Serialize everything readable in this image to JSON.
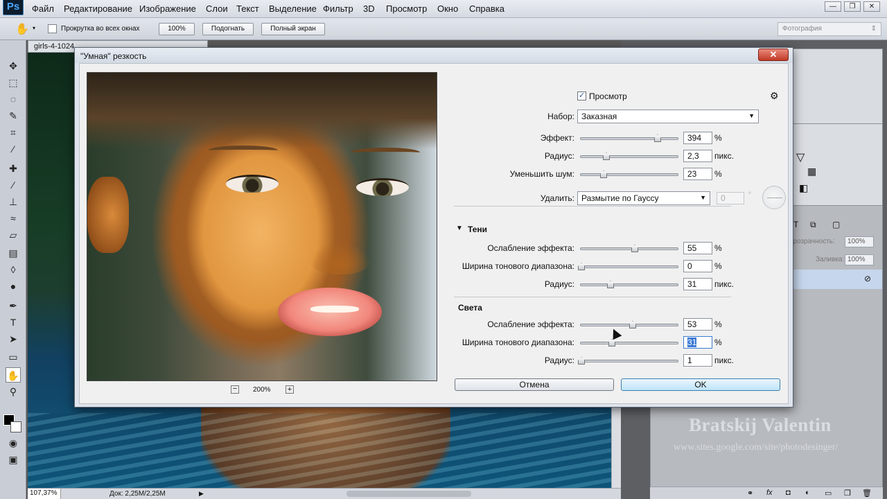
{
  "menubar": {
    "logo": "Ps",
    "items": [
      "Файл",
      "Редактирование",
      "Изображение",
      "Слои",
      "Текст",
      "Выделение",
      "Фильтр",
      "3D",
      "Просмотр",
      "Окно",
      "Справка"
    ]
  },
  "optionsbar": {
    "scroll_all_label": "Прокрутка во всех окнах",
    "btn_100": "100%",
    "btn_fit": "Подогнать",
    "btn_fullscreen": "Полный экран",
    "workspace": "Фотография"
  },
  "document": {
    "tab_title": "girls-4-1024",
    "zoom": "107,37%",
    "doc_size": "Док: 2,25M/2,25M"
  },
  "right_panels": {
    "opacity_label": "прозрачность:",
    "opacity_value": "100%",
    "fill_label": "Заливка:",
    "fill_value": "100%"
  },
  "watermark": {
    "name": "Bratskij Valentin",
    "url": "www.sites.google.com/site/photodesinger/"
  },
  "dialog": {
    "title": "\"Умная\" резкость",
    "close_label": "✕",
    "zoom_label": "200%",
    "zoom_out": "−",
    "zoom_in": "+",
    "preview_label": "Просмотр",
    "preset_label": "Набор:",
    "preset_value": "Заказная",
    "amount_label": "Эффект:",
    "amount_value": "394",
    "amount_unit": "%",
    "radius_label": "Радиус:",
    "radius_value": "2,3",
    "radius_unit": "пикс.",
    "noise_label": "Уменьшить шум:",
    "noise_value": "23",
    "noise_unit": "%",
    "remove_label": "Удалить:",
    "remove_value": "Размытие по Гауссу",
    "angle_value": "0",
    "angle_unit": "°",
    "shadows": {
      "title": "Тени",
      "fade_label": "Ослабление эффекта:",
      "fade_value": "55",
      "fade_unit": "%",
      "tonal_label": "Ширина тонового диапазона:",
      "tonal_value": "0",
      "tonal_unit": "%",
      "radius_label": "Радиус:",
      "radius_value": "31",
      "radius_unit": "пикс."
    },
    "highlights": {
      "title": "Света",
      "fade_label": "Ослабление эффекта:",
      "fade_value": "53",
      "fade_unit": "%",
      "tonal_label": "Ширина тонового диапазона:",
      "tonal_value": "31",
      "tonal_unit": "%",
      "radius_label": "Радиус:",
      "radius_value": "1",
      "radius_unit": "пикс."
    },
    "cancel_label": "Отмена",
    "ok_label": "OK"
  }
}
